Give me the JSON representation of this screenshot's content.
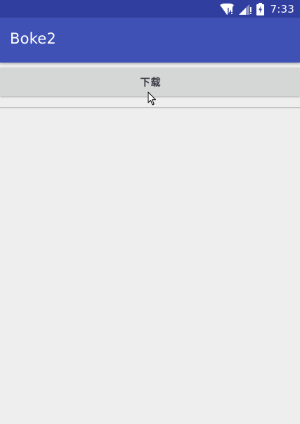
{
  "status_bar": {
    "time": "7:33",
    "icons": [
      "wifi-icon",
      "signal-icon",
      "battery-icon"
    ],
    "background": "#303f9f"
  },
  "app_bar": {
    "title": "Boke2",
    "background": "#3f51b5"
  },
  "main": {
    "download_button_label": "下载"
  },
  "colors": {
    "primary": "#3f51b5",
    "primary_dark": "#303f9f",
    "window_background": "#eeeeee",
    "button_background": "#d5d6d6"
  }
}
